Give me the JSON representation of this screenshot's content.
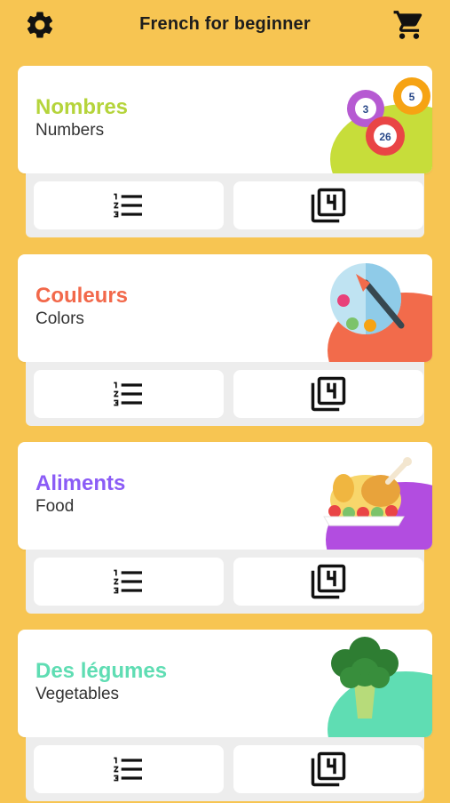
{
  "header": {
    "title": "French for beginner",
    "settings_icon": "gear-icon",
    "cart_icon": "cart-icon"
  },
  "categories": [
    {
      "french": "Nombres",
      "english": "Numbers",
      "color": "#B5D43B",
      "illustration": "lottery-balls",
      "balls": [
        "3",
        "5",
        "26"
      ]
    },
    {
      "french": "Couleurs",
      "english": "Colors",
      "color": "#F2684A",
      "illustration": "paint-palette"
    },
    {
      "french": "Aliments",
      "english": "Food",
      "color": "#8B5CF6",
      "illustration": "roast-chicken"
    },
    {
      "french": "Des légumes",
      "english": "Vegetables",
      "color": "#5FDDB3",
      "illustration": "broccoli"
    }
  ],
  "actions": {
    "list_icon": "numbered-list-icon",
    "flashcard_icon": "flashcards-4-icon"
  },
  "colors": {
    "background": "#F7C552",
    "card": "#FFFFFF",
    "tray": "#EDEDED"
  }
}
